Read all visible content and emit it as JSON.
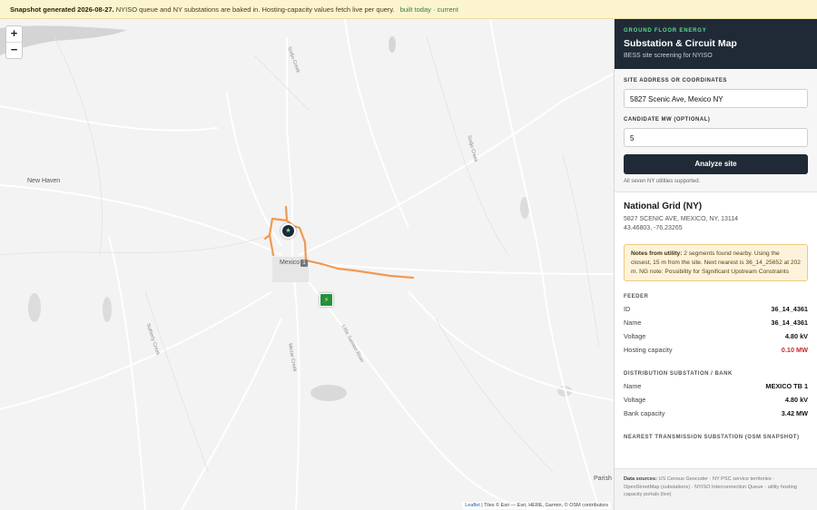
{
  "banner": {
    "bold": "Snapshot generated 2026-08-27.",
    "text": " NYISO queue and NY substations are baked in. Hosting-capacity values fetch live per query.",
    "status": "built today · current"
  },
  "map": {
    "zoom_in": "+",
    "zoom_out": "−",
    "places": {
      "new_haven": "New Haven",
      "mexico": "Mexico",
      "parish": "Parish"
    },
    "route_shield": "1",
    "road_labels": {
      "r1": "Sodjo Creek",
      "r2": "Sodjo Creek",
      "r3": "Sutherly Creek",
      "r4": "Little Salmon River",
      "r5": "Mezar Creek"
    },
    "attribution": {
      "leaflet": "Leaflet",
      "rest": " | Tiles © Esri — Esri, HERE, Garmin, © OSM contributors"
    },
    "site_marker_icon": "star-icon",
    "substation_marker_icon": "lightning-icon",
    "feeder_color": "#f09a52"
  },
  "panel": {
    "brand": "GROUND FLOOR ENERGY",
    "title": "Substation & Circuit Map",
    "subtitle": "BESS site screening for NYISO",
    "form": {
      "address_label": "SITE ADDRESS OR COORDINATES",
      "address_value": "5827 Scenic Ave, Mexico NY",
      "mw_label": "CANDIDATE MW (OPTIONAL)",
      "mw_value": "5",
      "button": "Analyze site",
      "note": "All seven NY utilities supported."
    },
    "result": {
      "utility": "National Grid (NY)",
      "address": "5827 SCENIC AVE, MEXICO, NY, 13114",
      "coords": "43.46803, -76.23265",
      "notes_label": "Notes from utility:",
      "notes_text": " 2 segments found nearby. Using the closest, 15 m from the site. Next nearest is 36_14_25652 at 202 m. NG note: Possibility for Significant Upstream Constraints",
      "feeder": {
        "heading": "FEEDER",
        "rows": [
          {
            "k": "ID",
            "v": "36_14_4361"
          },
          {
            "k": "Name",
            "v": "36_14_4361"
          },
          {
            "k": "Voltage",
            "v": "4.80 kV"
          },
          {
            "k": "Hosting capacity",
            "v": "0.10 MW"
          }
        ]
      },
      "distribution": {
        "heading": "DISTRIBUTION SUBSTATION / BANK",
        "rows": [
          {
            "k": "Name",
            "v": "MEXICO TB 1"
          },
          {
            "k": "Voltage",
            "v": "4.80 kV"
          },
          {
            "k": "Bank capacity",
            "v": "3.42 MW"
          }
        ]
      },
      "transmission_heading": "NEAREST TRANSMISSION SUBSTATION (OSM SNAPSHOT)"
    },
    "footer": {
      "label": "Data sources:",
      "text": " US Census Geocoder · NY PSC service territories · OpenStreetMap (substations) · NYISO Interconnection Queue · utility hosting capacity portals (live)"
    }
  }
}
